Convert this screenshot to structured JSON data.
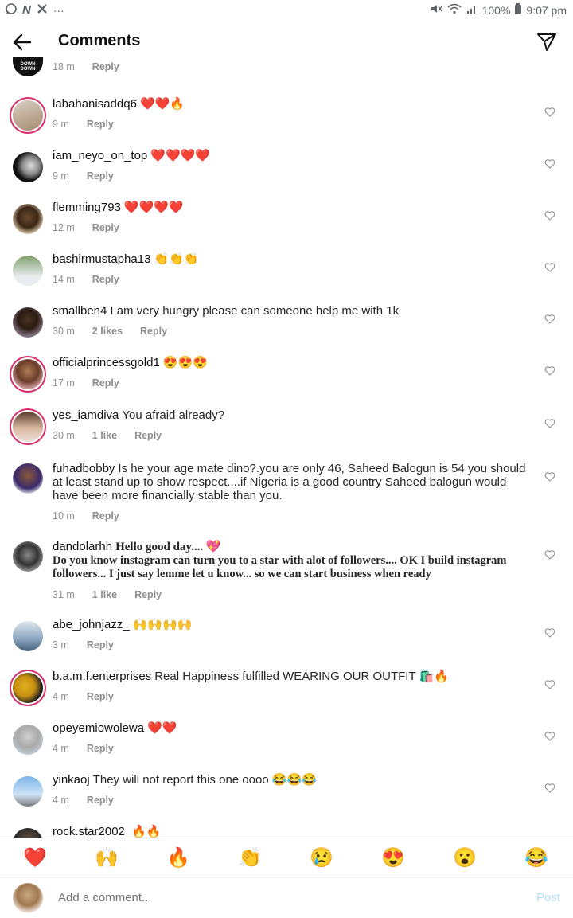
{
  "status": {
    "battery": "100%",
    "time": "9:07 pm"
  },
  "header": {
    "title": "Comments"
  },
  "colors": {
    "ring": "#d6316c",
    "heart": "#ed4956",
    "meta": "#8e8e8e",
    "post": "#b2dffc"
  },
  "top_partial": {
    "time": "18 m",
    "reply": "Reply",
    "avatar_text": "DOWN DOWN"
  },
  "comments": [
    {
      "user": "labahanisaddq6",
      "text": "❤️❤️🔥",
      "time": "9 m",
      "likes": "",
      "reply": "Reply"
    },
    {
      "user": "iam_neyo_on_top",
      "text": "❤️❤️❤️❤️",
      "time": "9 m",
      "likes": "",
      "reply": "Reply"
    },
    {
      "user": "flemming793",
      "text": "❤️❤️❤️❤️",
      "time": "12 m",
      "likes": "",
      "reply": "Reply"
    },
    {
      "user": "bashirmustapha13",
      "text": "👏👏👏",
      "time": "14 m",
      "likes": "",
      "reply": "Reply"
    },
    {
      "user": "smallben4",
      "text": "I  am very hungry please can someone help me with 1k",
      "time": "30 m",
      "likes": "2 likes",
      "reply": "Reply"
    },
    {
      "user": "officialprincessgold1",
      "text": "😍😍😍",
      "time": "17 m",
      "likes": "",
      "reply": "Reply"
    },
    {
      "user": "yes_iamdiva",
      "text": "You afraid already?",
      "time": "30 m",
      "likes": "1 like",
      "reply": "Reply"
    },
    {
      "user": "fuhadbobby",
      "text": "Is he your age mate dino?.you are only 46, Saheed Balogun is 54 you should at least stand up to show respect....if Nigeria is a good country Saheed balogun would have been more financially stable than you.",
      "time": "10 m",
      "likes": "",
      "reply": "Reply"
    },
    {
      "user": "dandolarhh",
      "text": "Hello good day.... 💖",
      "text2": " Do you know instagram can turn you to a star with alot of followers.... OK I build instagram followers... I just say lemme let u know... so we can start business when ready",
      "time": "31 m",
      "likes": "1 like",
      "reply": "Reply"
    },
    {
      "user": "abe_johnjazz_",
      "text": "🙌🙌🙌🙌",
      "time": "3 m",
      "likes": "",
      "reply": "Reply"
    },
    {
      "user": "b.a.m.f.enterprises",
      "text": "Real Happiness fulfilled WEARING OUR OUTFIT 🛍️🔥",
      "time": "4 m",
      "likes": "",
      "reply": "Reply"
    },
    {
      "user": "opeyemiowolewa",
      "text": "❤️❤️",
      "time": "4 m",
      "likes": "",
      "reply": "Reply"
    },
    {
      "user": "yinkaoj",
      "text": "They will not report this one oooo 😂😂😂",
      "time": "4 m",
      "likes": "",
      "reply": "Reply"
    },
    {
      "user": "rock.star2002",
      "text": " 🔥🔥",
      "time": "",
      "likes": "",
      "reply": ""
    }
  ],
  "emoji_bar": [
    "❤️",
    "🙌",
    "🔥",
    "👏",
    "😢",
    "😍",
    "😮",
    "😂"
  ],
  "input": {
    "placeholder": "Add a comment...",
    "post_label": "Post"
  }
}
